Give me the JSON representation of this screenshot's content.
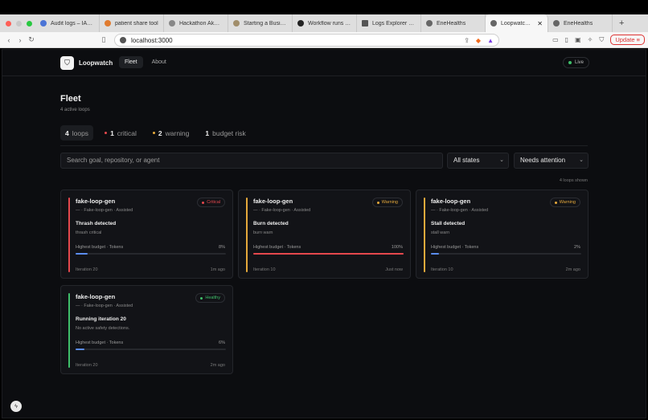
{
  "browser": {
    "tabs": [
      {
        "label": "Audit logs – IAM &",
        "color": "#4b74d6"
      },
      {
        "label": "patient share tool",
        "color": "#e07b2f"
      },
      {
        "label": "Hackathon Akash",
        "color": "#888888"
      },
      {
        "label": "Starting a Busines",
        "color": "#a18e6b"
      },
      {
        "label": "Workflow runs · N",
        "color": "#222222"
      },
      {
        "label": "Logs Explorer – L",
        "color": "#555555"
      },
      {
        "label": "EneHealths",
        "color": "#666666"
      },
      {
        "label": "Loopwatch M",
        "color": "#666666"
      },
      {
        "label": "EneHealths",
        "color": "#666666"
      }
    ],
    "url": "localhost:3000",
    "update_label": "Update"
  },
  "app": {
    "brand": "Loopwatch",
    "nav": {
      "fleet": "Fleet",
      "about": "About"
    },
    "live": "Live",
    "title": "Fleet",
    "subtitle": "4 active loops",
    "summary": {
      "loops_count": "4",
      "loops_label": "loops",
      "critical_count": "1",
      "critical_label": "critical",
      "warning_count": "2",
      "warning_label": "warning",
      "budget_count": "1",
      "budget_label": "budget risk"
    },
    "search_placeholder": "Search goal, repository, or agent",
    "state_filter": "All states",
    "sort_filter": "Needs attention",
    "shown_text": "4 loops shown",
    "colors": {
      "critical": "#e5484d",
      "warning": "#e5a93b",
      "healthy": "#3fbf6a",
      "fill_blue": "#5b8def",
      "fill_red": "#e5484d"
    }
  },
  "cards": [
    {
      "name": "fake-loop-gen",
      "meta": "— · Fake-loop-gen · Assisted",
      "badge": "Critical",
      "status": "Thrash detected",
      "detail": "thrash critical",
      "budget_label": "Highest budget · Tokens",
      "budget_pct": "8%",
      "budget_fraction": 0.08,
      "iteration": "Iteration 20",
      "time": "1m ago"
    },
    {
      "name": "fake-loop-gen",
      "meta": "— · Fake-loop-gen · Assisted",
      "badge": "Warning",
      "status": "Burn detected",
      "detail": "burn warn",
      "budget_label": "Highest budget · Tokens",
      "budget_pct": "100%",
      "budget_fraction": 1.0,
      "iteration": "Iteration 10",
      "time": "Just now"
    },
    {
      "name": "fake-loop-gen",
      "meta": "— · Fake-loop-gen · Assisted",
      "badge": "Warning",
      "status": "Stall detected",
      "detail": "stall warn",
      "budget_label": "Highest budget · Tokens",
      "budget_pct": "2%",
      "budget_fraction": 0.02,
      "iteration": "Iteration 10",
      "time": "2m ago"
    },
    {
      "name": "fake-loop-gen",
      "meta": "— · Fake-loop-gen · Assisted",
      "badge": "Healthy",
      "status": "Running iteration 20",
      "detail": "No active safety detections.",
      "budget_label": "Highest budget · Tokens",
      "budget_pct": "6%",
      "budget_fraction": 0.06,
      "iteration": "Iteration 20",
      "time": "2m ago"
    }
  ]
}
